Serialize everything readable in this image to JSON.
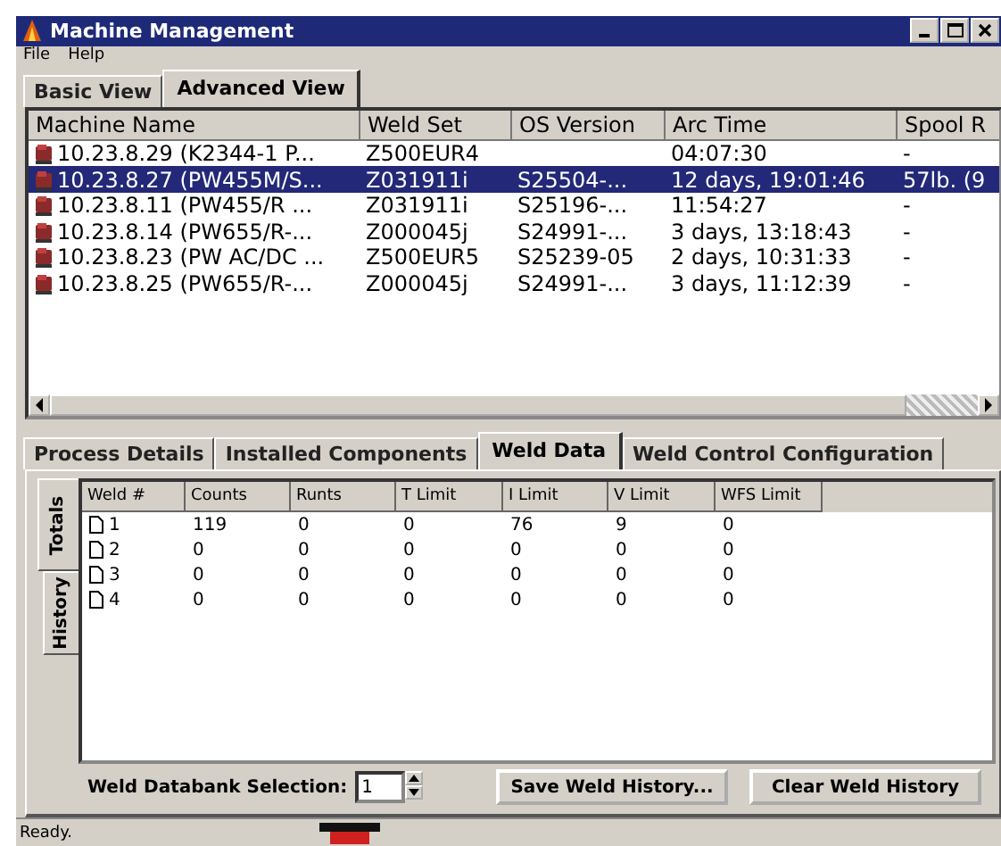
{
  "window": {
    "title": "Machine Management"
  },
  "menu": [
    "File",
    "Help"
  ],
  "view_tabs": [
    {
      "label": "Basic View",
      "selected": false
    },
    {
      "label": "Advanced View",
      "selected": true
    }
  ],
  "machines": {
    "columns": [
      "Machine Name",
      "Weld Set",
      "OS Version",
      "Arc Time",
      "Spool R"
    ],
    "rows": [
      {
        "cells": [
          "10.23.8.29 (K2344-1 P...",
          "Z500EUR4",
          "",
          "04:07:30",
          "-"
        ],
        "selected": false
      },
      {
        "cells": [
          "10.23.8.27 (PW455M/S...",
          "Z031911i",
          "S25504-...",
          "12 days, 19:01:46",
          "57lb. (9"
        ],
        "selected": true
      },
      {
        "cells": [
          "10.23.8.11 (PW455/R ...",
          "Z031911i",
          "S25196-...",
          "11:54:27",
          "-"
        ],
        "selected": false
      },
      {
        "cells": [
          "10.23.8.14 (PW655/R-...",
          "Z000045j",
          "S24991-...",
          "3 days, 13:18:43",
          "-"
        ],
        "selected": false
      },
      {
        "cells": [
          "10.23.8.23 (PW AC/DC ...",
          "Z500EUR5",
          "S25239-05",
          "2 days, 10:31:33",
          "-"
        ],
        "selected": false
      },
      {
        "cells": [
          "10.23.8.25 (PW655/R-...",
          "Z000045j",
          "S24991-...",
          "3 days, 11:12:39",
          "-"
        ],
        "selected": false
      }
    ]
  },
  "detail_tabs": [
    {
      "label": "Process Details",
      "selected": false
    },
    {
      "label": "Installed Components",
      "selected": false
    },
    {
      "label": "Weld Data",
      "selected": true
    },
    {
      "label": "Weld Control Configuration",
      "selected": false
    }
  ],
  "side_tabs": [
    {
      "label": "Totals",
      "selected": true
    },
    {
      "label": "History",
      "selected": false
    }
  ],
  "weld_table": {
    "columns": [
      "Weld #",
      "Counts",
      "Runts",
      "T Limit",
      "I Limit",
      "V Limit",
      "WFS Limit"
    ],
    "rows": [
      [
        "1",
        "119",
        "0",
        "0",
        "76",
        "9",
        "0"
      ],
      [
        "2",
        "0",
        "0",
        "0",
        "0",
        "0",
        "0"
      ],
      [
        "3",
        "0",
        "0",
        "0",
        "0",
        "0",
        "0"
      ],
      [
        "4",
        "0",
        "0",
        "0",
        "0",
        "0",
        "0"
      ]
    ]
  },
  "databank": {
    "label": "Weld Databank Selection:",
    "value": "1"
  },
  "buttons": [
    "Save Weld History...",
    "Clear Weld History"
  ],
  "status_bar": "Ready."
}
